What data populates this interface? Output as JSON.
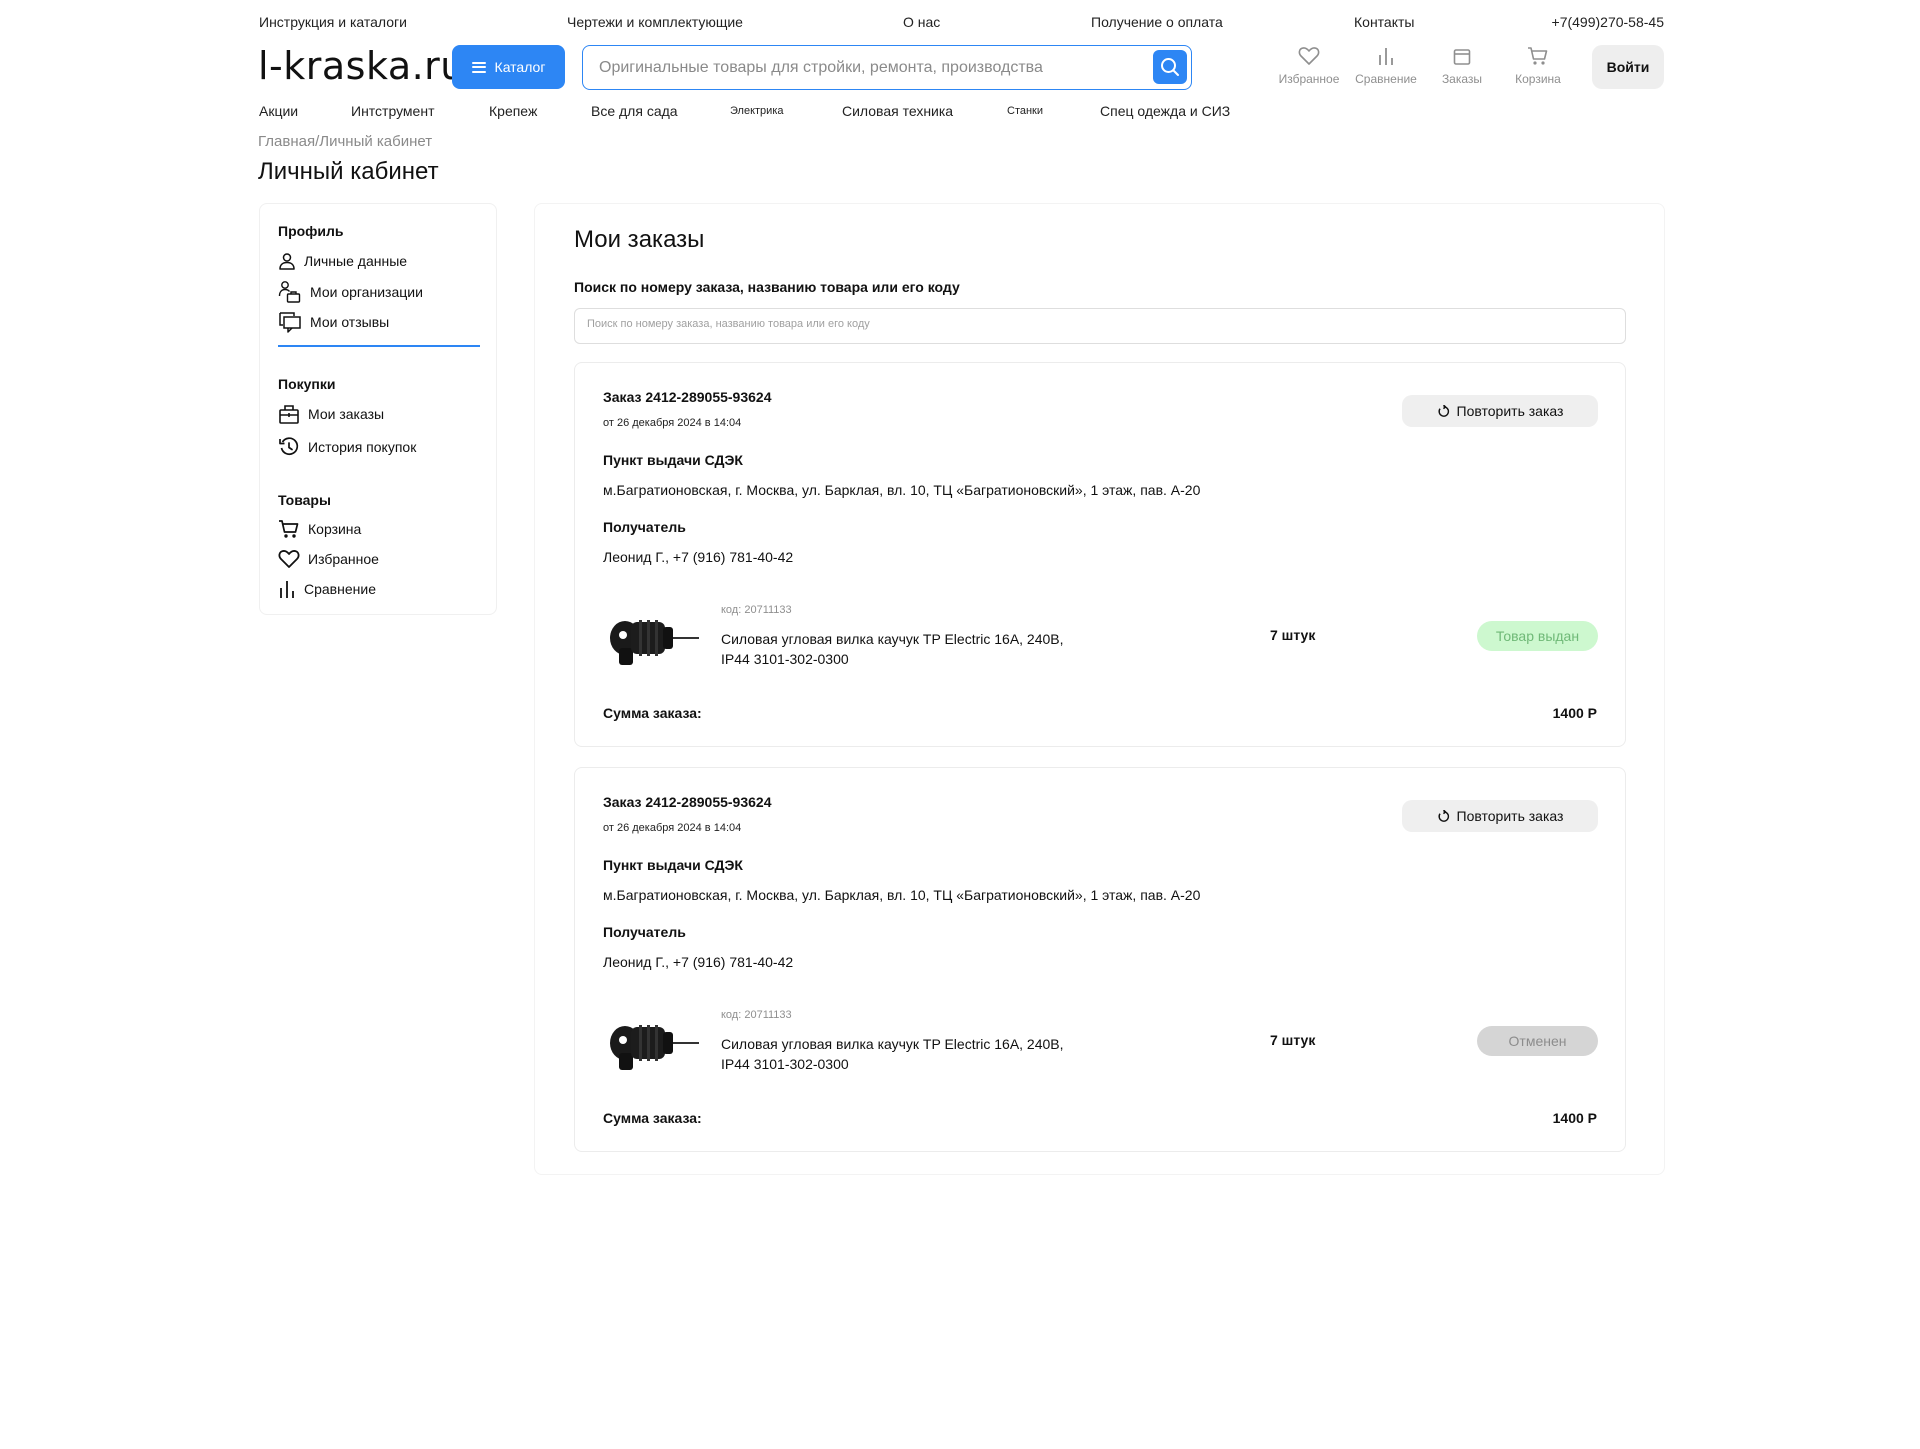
{
  "topbar": {
    "links": [
      "Инструкция и каталоги",
      "Чертежи и комплектующие",
      "О нас",
      "Получение о оплата",
      "Контакты"
    ],
    "phone": "+7(499)270-58-45"
  },
  "header": {
    "logo": "l-kraska.ru",
    "catalog_label": "Каталог",
    "search_placeholder": "Оригинальные товары для стройки, ремонта, производства",
    "icons": [
      {
        "label": "Избранное",
        "icon": "heart-icon"
      },
      {
        "label": "Сравнение",
        "icon": "bar-chart-icon"
      },
      {
        "label": "Заказы",
        "icon": "orders-icon"
      },
      {
        "label": "Корзина",
        "icon": "cart-icon"
      }
    ],
    "login_label": "Войти"
  },
  "nav": [
    "Акции",
    "Интструмент",
    "Крепеж",
    "Все для сада",
    "Электрика",
    "Силовая техника",
    "Станки",
    "Спец одежда и СИЗ"
  ],
  "breadcrumb": "Главная/Личный кабинет",
  "page_title": "Личный кабинет",
  "sidebar": {
    "profile_heading": "Профиль",
    "profile_items": [
      "Личные данные",
      "Мои организации",
      "Мои отзывы"
    ],
    "purchases_heading": "Покупки",
    "purchases_items": [
      "Мои заказы",
      "История покупок"
    ],
    "goods_heading": "Товары",
    "goods_items": [
      "Корзина",
      "Избранное",
      "Сравнение"
    ]
  },
  "main": {
    "title": "Мои заказы",
    "search_label": "Поиск по номеру заказа, названию товара или его коду",
    "search_placeholder": "Поиск по номеру заказа, названию товара или его коду"
  },
  "orders": [
    {
      "title": "Заказ 2412-289055-93624",
      "date": "от 26 декабря 2024 в 14:04",
      "repeat_label": "Повторить заказ",
      "pickup_label": "Пункт выдачи СДЭК",
      "address": "м.Багратионовская, г. Москва, ул. Барклая, вл. 10, ТЦ «Багратионовский», 1 этаж, пав. А-20",
      "recipient_label": "Получатель",
      "recipient": "Леонид Г.,  +7 (916) 781-40-42",
      "product_code": "код: 20711133",
      "product_name_line1": "Силовая угловая вилка каучук TP Electric 16А, 240В,",
      "product_name_line2": "IP44 3101-302-0300",
      "quantity": "7 штук",
      "status": "Товар выдан",
      "status_color": "#cdf8cf",
      "sum_label": "Сумма заказа:",
      "sum": "1400 Р"
    },
    {
      "title": "Заказ 2412-289055-93624",
      "date": "от 26 декабря 2024 в 14:04",
      "repeat_label": "Повторить заказ",
      "pickup_label": "Пункт выдачи СДЭК",
      "address": "м.Багратионовская, г. Москва, ул. Барклая, вл. 10, ТЦ «Багратионовский», 1 этаж, пав. А-20",
      "recipient_label": "Получатель",
      "recipient": "Леонид Г.,  +7 (916) 781-40-42",
      "product_code": "код: 20711133",
      "product_name_line1": "Силовая угловая вилка каучук TP Electric 16А, 240В,",
      "product_name_line2": "IP44 3101-302-0300",
      "quantity": "7 штук",
      "status": "Отменен",
      "status_color": "#d5d5d5",
      "sum_label": "Сумма заказа:",
      "sum": "1400 Р"
    }
  ],
  "colors": {
    "accent": "#2d86f4",
    "status_ok_text": "#6fb977",
    "status_cancel_text": "#8c8c8c"
  }
}
